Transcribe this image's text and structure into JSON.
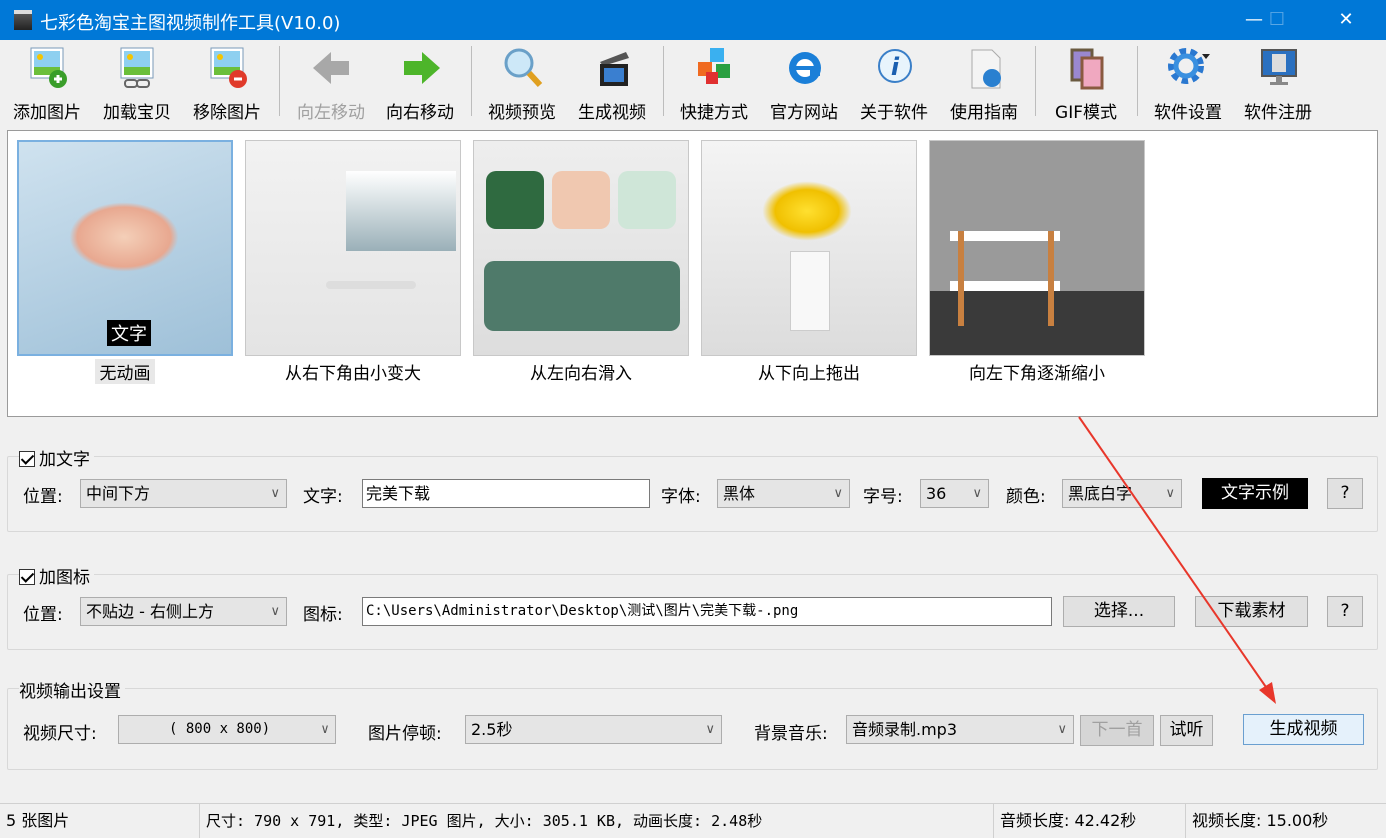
{
  "window": {
    "title": "七彩色淘宝主图视频制作工具(V10.0)"
  },
  "toolbar": [
    {
      "label": "添加图片",
      "icon": "add-image-icon",
      "enabled": true
    },
    {
      "label": "加载宝贝",
      "icon": "load-item-icon",
      "enabled": true
    },
    {
      "label": "移除图片",
      "icon": "remove-image-icon",
      "enabled": true
    },
    {
      "label": "向左移动",
      "icon": "arrow-left-icon",
      "enabled": false
    },
    {
      "label": "向右移动",
      "icon": "arrow-right-icon",
      "enabled": true
    },
    {
      "label": "视频预览",
      "icon": "magnifier-icon",
      "enabled": true
    },
    {
      "label": "生成视频",
      "icon": "clapperboard-icon",
      "enabled": true
    },
    {
      "label": "快捷方式",
      "icon": "cubes-icon",
      "enabled": true
    },
    {
      "label": "官方网站",
      "icon": "ie-icon",
      "enabled": true
    },
    {
      "label": "关于软件",
      "icon": "info-icon",
      "enabled": true
    },
    {
      "label": "使用指南",
      "icon": "html-doc-icon",
      "enabled": true
    },
    {
      "label": "GIF模式",
      "icon": "film-icon",
      "enabled": true
    },
    {
      "label": "软件设置",
      "icon": "gear-icon",
      "enabled": true
    },
    {
      "label": "软件注册",
      "icon": "monitor-icon",
      "enabled": true
    }
  ],
  "thumbnails": [
    {
      "caption": "无动画",
      "overlay_text": "文字",
      "selected": true
    },
    {
      "caption": "从右下角由小变大"
    },
    {
      "caption": "从左向右滑入"
    },
    {
      "caption": "从下向上拖出"
    },
    {
      "caption": "向左下角逐渐缩小"
    }
  ],
  "text_group": {
    "title": "加文字",
    "checked": true,
    "position_label": "位置:",
    "position_value": "中间下方",
    "text_label": "文字:",
    "text_value": "完美下载",
    "font_label": "字体:",
    "font_value": "黑体",
    "size_label": "字号:",
    "size_value": "36",
    "color_label": "颜色:",
    "color_value": "黑底白字",
    "sample_button": "文字示例",
    "help": "?"
  },
  "icon_group": {
    "title": "加图标",
    "checked": true,
    "position_label": "位置:",
    "position_value": "不贴边 - 右侧上方",
    "icon_label": "图标:",
    "icon_path": "C:\\Users\\Administrator\\Desktop\\测试\\图片\\完美下载-.png",
    "choose_button": "选择...",
    "download_button": "下载素材",
    "help": "?"
  },
  "output_group": {
    "title": "视频输出设置",
    "size_label": "视频尺寸:",
    "size_value": "( 800 x  800)",
    "pause_label": "图片停顿:",
    "pause_value": "2.5秒",
    "music_label": "背景音乐:",
    "music_value": "音频录制.mp3",
    "next_button": "下一首",
    "listen_button": "试听",
    "generate_button": "生成视频"
  },
  "status": {
    "count": "5 张图片",
    "info": "尺寸: 790 x 791, 类型: JPEG 图片, 大小: 305.1 KB, 动画长度: 2.48秒",
    "audio": "音频长度: 42.42秒",
    "video": "视频长度: 15.00秒"
  },
  "colors": {
    "titlebar": "#0078d7",
    "annotation_arrow": "#e8372b"
  }
}
